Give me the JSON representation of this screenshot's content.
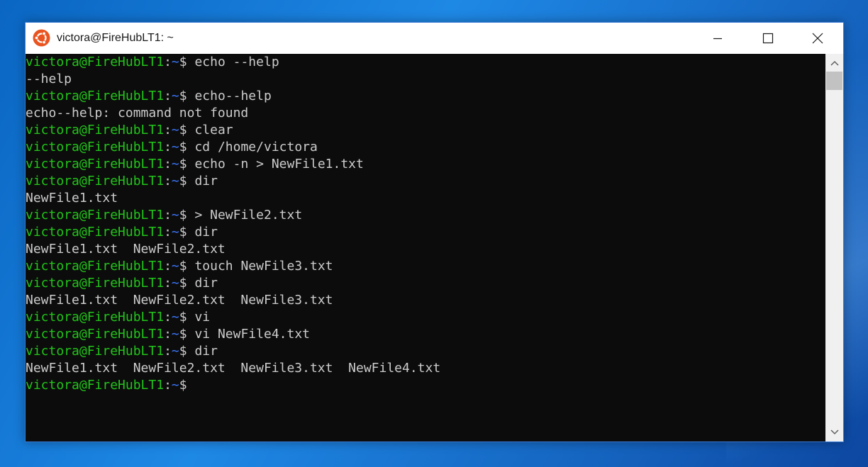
{
  "window": {
    "title": "victora@FireHubLT1: ~",
    "icon": "ubuntu-icon",
    "controls": [
      "minimize-icon",
      "maximize-icon",
      "close-icon"
    ]
  },
  "colors": {
    "prompt_user": "#22c51a",
    "prompt_path": "#3b78ff",
    "text": "#cccccc",
    "background": "#0c0c0c"
  },
  "prompt": {
    "user": "victora@FireHubLT1",
    "sep": ":",
    "path": "~",
    "dollar": "$"
  },
  "terminal": {
    "lines": [
      {
        "prompt": true,
        "cmd": " echo --help"
      },
      {
        "prompt": false,
        "text": "--help"
      },
      {
        "prompt": true,
        "cmd": " echo--help"
      },
      {
        "prompt": false,
        "text": "echo--help: command not found"
      },
      {
        "prompt": true,
        "cmd": " clear"
      },
      {
        "prompt": true,
        "cmd": " cd /home/victora"
      },
      {
        "prompt": true,
        "cmd": " echo -n > NewFile1.txt"
      },
      {
        "prompt": true,
        "cmd": " dir"
      },
      {
        "prompt": false,
        "text": "NewFile1.txt"
      },
      {
        "prompt": true,
        "cmd": " > NewFile2.txt"
      },
      {
        "prompt": true,
        "cmd": " dir"
      },
      {
        "prompt": false,
        "text": "NewFile1.txt  NewFile2.txt"
      },
      {
        "prompt": true,
        "cmd": " touch NewFile3.txt"
      },
      {
        "prompt": true,
        "cmd": " dir"
      },
      {
        "prompt": false,
        "text": "NewFile1.txt  NewFile2.txt  NewFile3.txt"
      },
      {
        "prompt": true,
        "cmd": " vi"
      },
      {
        "prompt": true,
        "cmd": " vi NewFile4.txt"
      },
      {
        "prompt": true,
        "cmd": " dir"
      },
      {
        "prompt": false,
        "text": "NewFile1.txt  NewFile2.txt  NewFile3.txt  NewFile4.txt"
      },
      {
        "prompt": true,
        "cmd": ""
      }
    ]
  }
}
